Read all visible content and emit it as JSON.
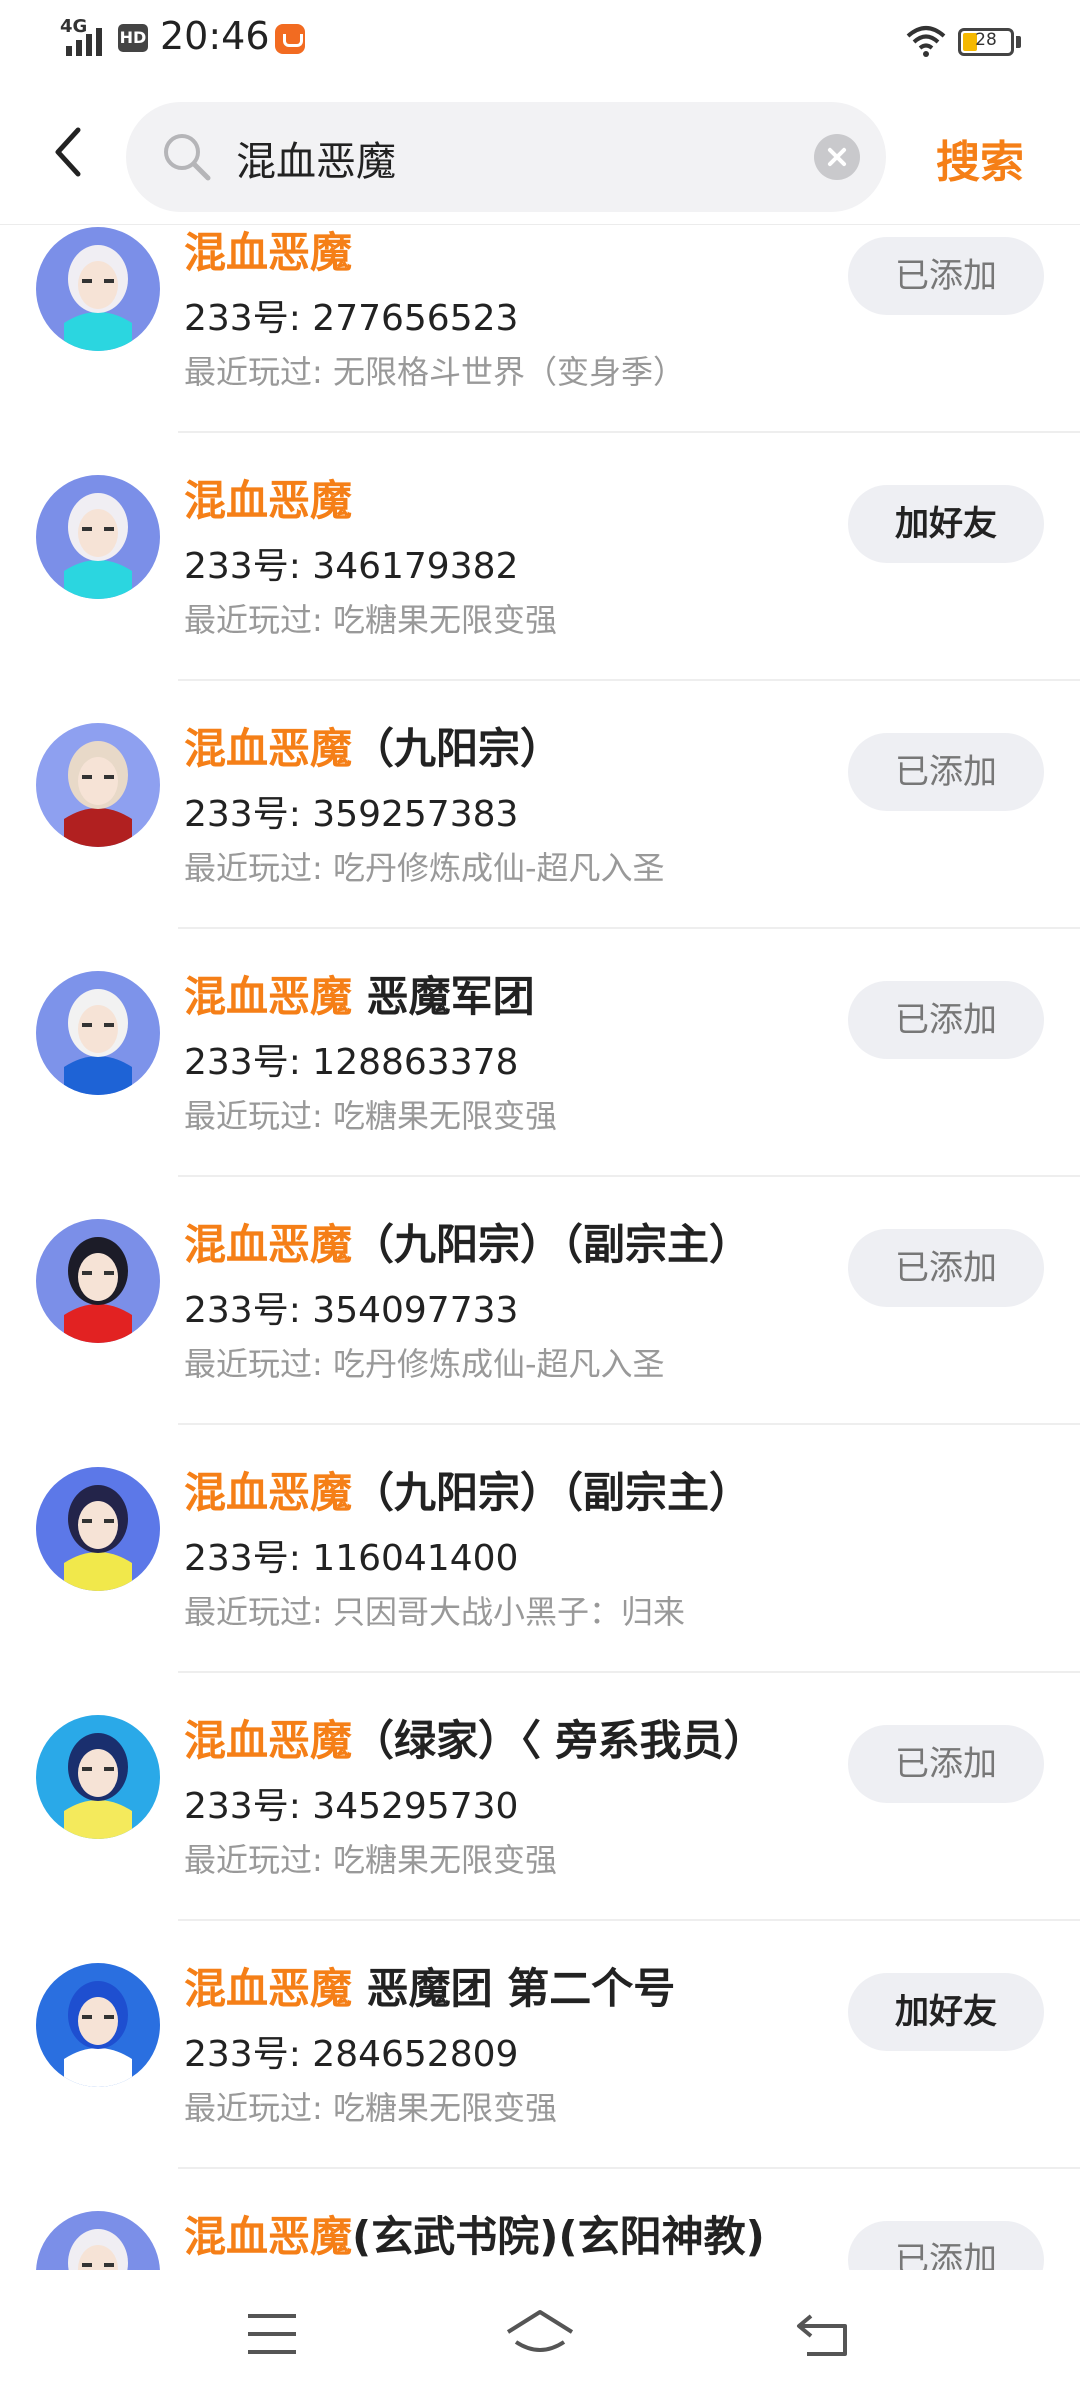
{
  "status_bar": {
    "network": "4G",
    "hd_badge": "HD",
    "time": "20:46",
    "battery": "28"
  },
  "search": {
    "query": "混血恶魔",
    "submit_label": "搜索"
  },
  "results": [
    {
      "name_highlight": "混血恶魔",
      "name_rest": "",
      "uid": "233号: 277656523",
      "recent": "最近玩过: 无限格斗世界（变身季）",
      "action": "已添加",
      "state": "added"
    },
    {
      "name_highlight": "混血恶魔",
      "name_rest": "",
      "uid": "233号: 346179382",
      "recent": "最近玩过: 吃糖果无限变强",
      "action": "加好友",
      "state": "add"
    },
    {
      "name_highlight": "混血恶魔",
      "name_rest": "（九阳宗）",
      "uid": "233号: 359257383",
      "recent": "最近玩过: 吃丹修炼成仙-超凡入圣",
      "action": "已添加",
      "state": "added"
    },
    {
      "name_highlight": "混血恶魔",
      "name_rest": " 恶魔军团",
      "uid": "233号: 128863378",
      "recent": "最近玩过: 吃糖果无限变强",
      "action": "已添加",
      "state": "added"
    },
    {
      "name_highlight": "混血恶魔",
      "name_rest": "（九阳宗）（副宗主）",
      "uid": "233号: 354097733",
      "recent": "最近玩过: 吃丹修炼成仙-超凡入圣",
      "action": "已添加",
      "state": "added"
    },
    {
      "name_highlight": "混血恶魔",
      "name_rest": "（九阳宗）（副宗主）",
      "uid": "233号: 116041400",
      "recent": "最近玩过: 只因哥大战小黑子：归来",
      "action": "",
      "state": "none"
    },
    {
      "name_highlight": "混血恶魔",
      "name_rest": "（绿家）〈 旁系我员）",
      "uid": "233号: 345295730",
      "recent": "最近玩过: 吃糖果无限变强",
      "action": "已添加",
      "state": "added"
    },
    {
      "name_highlight": "混血恶魔",
      "name_rest": " 恶魔团 第二个号",
      "uid": "233号: 284652809",
      "recent": "最近玩过: 吃糖果无限变强",
      "action": "加好友",
      "state": "add"
    },
    {
      "name_highlight": "混血恶魔",
      "name_rest": "(玄武书院)(玄阳神教)",
      "uid": "",
      "recent": "",
      "action": "已添加",
      "state": "added"
    }
  ],
  "avatar_styles": [
    {
      "bg": "#7b8fe8",
      "hair": "#f0eef3",
      "body": "#2bd6e0"
    },
    {
      "bg": "#7b8fe8",
      "hair": "#f0eef3",
      "body": "#2bd6e0"
    },
    {
      "bg": "#8ea0f0",
      "hair": "#e8d9c8",
      "body": "#b12020"
    },
    {
      "bg": "#7d93ea",
      "hair": "#f2f2f2",
      "body": "#1e63d6"
    },
    {
      "bg": "#7b8fe8",
      "hair": "#1c1c28",
      "body": "#e22222"
    },
    {
      "bg": "#5c78e8",
      "hair": "#23244a",
      "body": "#f1e84b"
    },
    {
      "bg": "#2aa9e8",
      "hair": "#1a2f6e",
      "body": "#f4ea5c"
    },
    {
      "bg": "#2a6fe0",
      "hair": "#1e4fd0",
      "body": "#ffffff"
    },
    {
      "bg": "#7b8fe8",
      "hair": "#f0eef3",
      "body": "#b0b8d0"
    }
  ],
  "colors": {
    "accent": "#f57f17",
    "button_bg": "#eeeff3"
  }
}
